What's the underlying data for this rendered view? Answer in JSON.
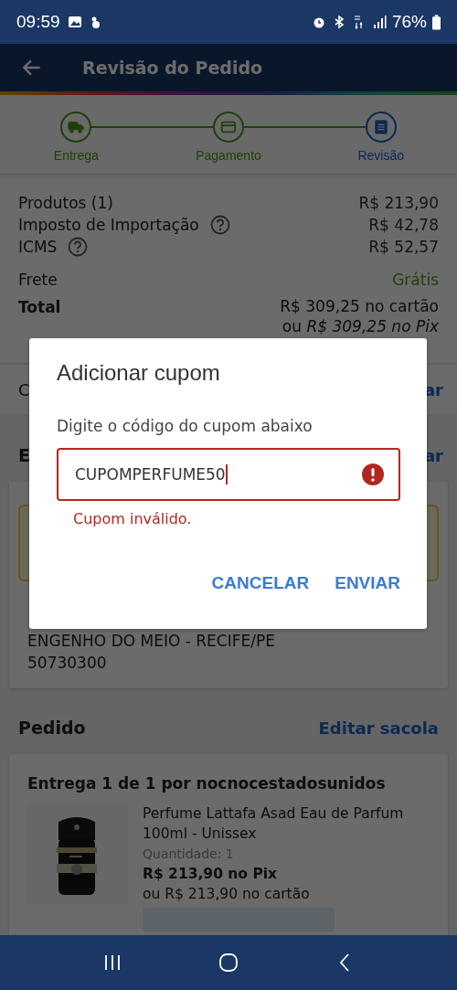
{
  "status_bar": {
    "time": "09:59",
    "battery": "76%"
  },
  "app_bar": {
    "title": "Revisão do Pedido"
  },
  "steps": [
    {
      "label": "Entrega",
      "current": false
    },
    {
      "label": "Pagamento",
      "current": false
    },
    {
      "label": "Revisão",
      "current": true
    }
  ],
  "summary": [
    {
      "label": "Produtos (1)",
      "value": "R$ 213,90",
      "help": false,
      "free": false
    },
    {
      "label": "Imposto de Importação",
      "value": "R$ 42,78",
      "help": true,
      "free": false
    },
    {
      "label": "ICMS",
      "value": "R$ 52,57",
      "help": true,
      "free": false
    },
    {
      "label": "Frete",
      "value": "Grátis",
      "help": false,
      "free": true
    }
  ],
  "total": {
    "label": "Total",
    "card": "R$ 309,25 no cartão",
    "pix": "ou *R$ 309,25 no Pix*"
  },
  "coupon_row": {
    "label": "C",
    "link": "ar"
  },
  "address": {
    "title": "E",
    "link": "ar",
    "lines": [
      "ENGENHO DO MEIO - RECIFE/PE",
      "50730300"
    ]
  },
  "order": {
    "title": "Pedido",
    "link": "Editar sacola",
    "shipment": "Entrega 1 de 1 por nocnocestadosunidos",
    "product": {
      "name": "Perfume Lattafa Asad Eau de Parfum 100ml - Unissex",
      "quantity": "Quantidade:  1",
      "price_pix": "R$ 213,90 no Pix",
      "price_card": "ou R$ 213,90 no cartão"
    }
  },
  "dialog": {
    "title": "Adicionar cupom",
    "label": "Digite o código do cupom abaixo",
    "value": "CUPOMPERFUME50",
    "error": "Cupom inválido.",
    "buttons": [
      "CANCELAR",
      "ENVIAR"
    ]
  }
}
